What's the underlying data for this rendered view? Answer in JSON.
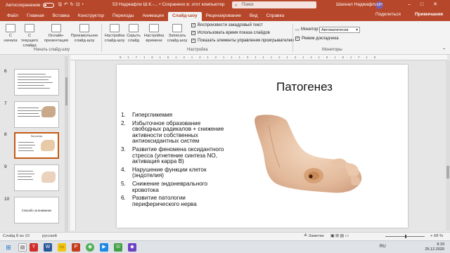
{
  "titlebar": {
    "autosave_label": "Автосохранение",
    "qat_icons": "🖫↶↻⊡▾",
    "doc_title": "53 Наджафли Ш.К.-... • Сохранено в: этот компьютер",
    "search_placeholder": "Поиск",
    "user_name": "Шахнал Наджафли",
    "avatar_initials": "ШН",
    "window_buttons": "–□✕"
  },
  "tabs": [
    "Файл",
    "Главная",
    "Вставка",
    "Конструктор",
    "Переходы",
    "Анимация",
    "Слайд-шоу",
    "Рецензирование",
    "Вид",
    "Справка"
  ],
  "active_tab": "Слайд-шоу",
  "share_label": "Поделиться",
  "notes_label": "Примечания",
  "ribbon": {
    "start_group": {
      "btn_from_start": "С начала",
      "btn_from_current": "С текущего слайда",
      "btn_online": "Онлайн-презентация",
      "btn_custom": "Произвольное слайд-шоу",
      "label": "Начать слайд-шоу"
    },
    "setup_group": {
      "btn_setup": "Настройка слайд-шоу",
      "btn_hide": "Скрыть слайд",
      "btn_timing": "Настройка времени",
      "btn_record": "Записать слайд-шоу",
      "chk_narration": "Воспроизвести закадровый текст",
      "chk_timings": "Использовать время показа слайдов",
      "chk_controls": "Показать элементы управления проигрывателем",
      "label": "Настройка"
    },
    "monitors_group": {
      "monitor_label": "Монитор:",
      "monitor_value": "Автоматически",
      "presenter_view": "Режим докладчика",
      "label": "Мониторы"
    }
  },
  "thumbnails": [
    {
      "num": "6",
      "title": "",
      "selected": false
    },
    {
      "num": "7",
      "title": "",
      "selected": false
    },
    {
      "num": "8",
      "title": "Патогенез",
      "selected": true
    },
    {
      "num": "9",
      "title": "",
      "selected": false
    },
    {
      "num": "10",
      "title": "Спасибо за внимание",
      "selected": false
    }
  ],
  "ruler_ticks": "8 · 1 · 7 · 1 · 6 · 1 · 5 · 1 · 4 · 1 · 3 · 1 · 2 · 1 · 1 · 1 · 0 · 1 · 1 · 1 · 2 · 1 · 3 · 1 · 4 · 1 · 5 · 1 · 6 · 1 · 7 · 1 · 8",
  "slide": {
    "title": "Патогенез",
    "items": [
      {
        "num": "1.",
        "text": "Гипергликемия"
      },
      {
        "num": "2.",
        "text": "Избыточное образование свободных радикалов + снижение активности собственных антиоксидантных систем"
      },
      {
        "num": "3.",
        "text": "Развитие феномена оксидантного стресса (угнетение синтеза NO, активация карра B)"
      },
      {
        "num": "4.",
        "text": "Нарушение функции клеток (эндотелия)"
      },
      {
        "num": "5.",
        "text": "Снижение эндоневрального кровотока"
      },
      {
        "num": "6.",
        "text": "Развитие патологии периферического нерва"
      }
    ]
  },
  "statusbar": {
    "slide_info": "Слайд 8 из 10",
    "language": "русский",
    "notes": "≜ Заметки",
    "view_icons": "▣ ⊞ ▤ ▭",
    "zoom": "+ 68 %"
  },
  "taskbar": {
    "language": "RU",
    "time": "9:19",
    "date": "25.12.2020"
  },
  "colors": {
    "accent": "#b7472a",
    "selection": "#c55a11"
  }
}
